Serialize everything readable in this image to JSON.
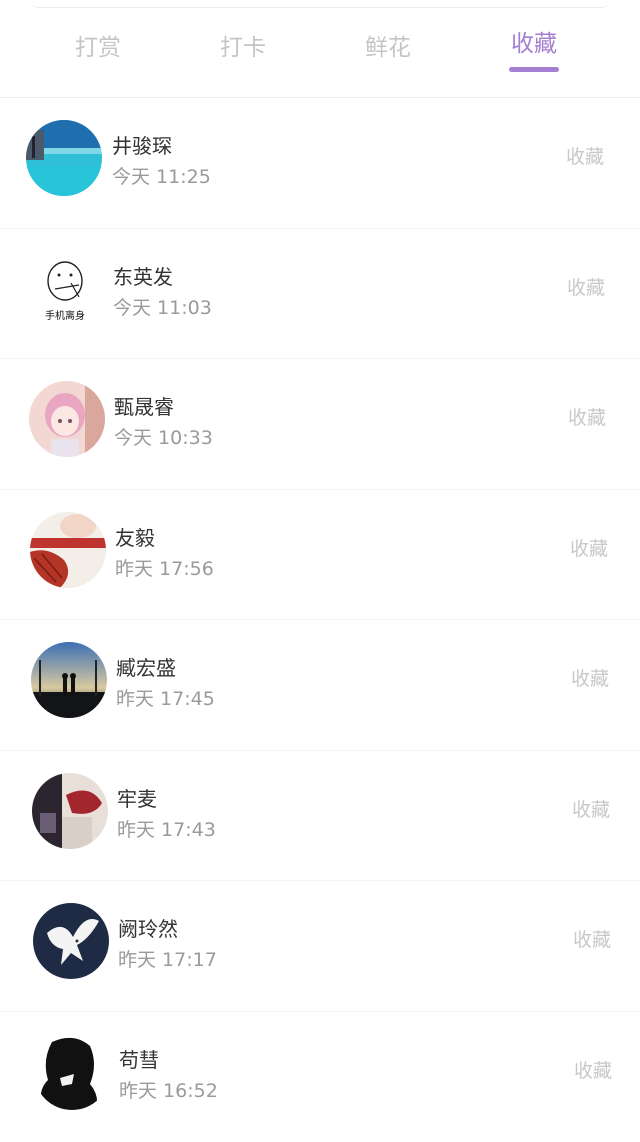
{
  "tabs": [
    {
      "label": "打赏"
    },
    {
      "label": "打卡"
    },
    {
      "label": "鲜花"
    },
    {
      "label": "收藏",
      "active": true
    }
  ],
  "accent_color": "#a57fd1",
  "avatar_text": "手机离身",
  "list": [
    {
      "name": "井骏琛",
      "time": "今天 11:25",
      "action": "收藏"
    },
    {
      "name": "东英发",
      "time": "今天 11:03",
      "action": "收藏"
    },
    {
      "name": "甄晟睿",
      "time": "今天 10:33",
      "action": "收藏"
    },
    {
      "name": "友毅",
      "time": "昨天 17:56",
      "action": "收藏"
    },
    {
      "name": "臧宏盛",
      "time": "昨天 17:45",
      "action": "收藏"
    },
    {
      "name": "牢麦",
      "time": "昨天 17:43",
      "action": "收藏"
    },
    {
      "name": "阙玲然",
      "time": "昨天 17:17",
      "action": "收藏"
    },
    {
      "name": "苟彗",
      "time": "昨天 16:52",
      "action": "收藏"
    }
  ]
}
